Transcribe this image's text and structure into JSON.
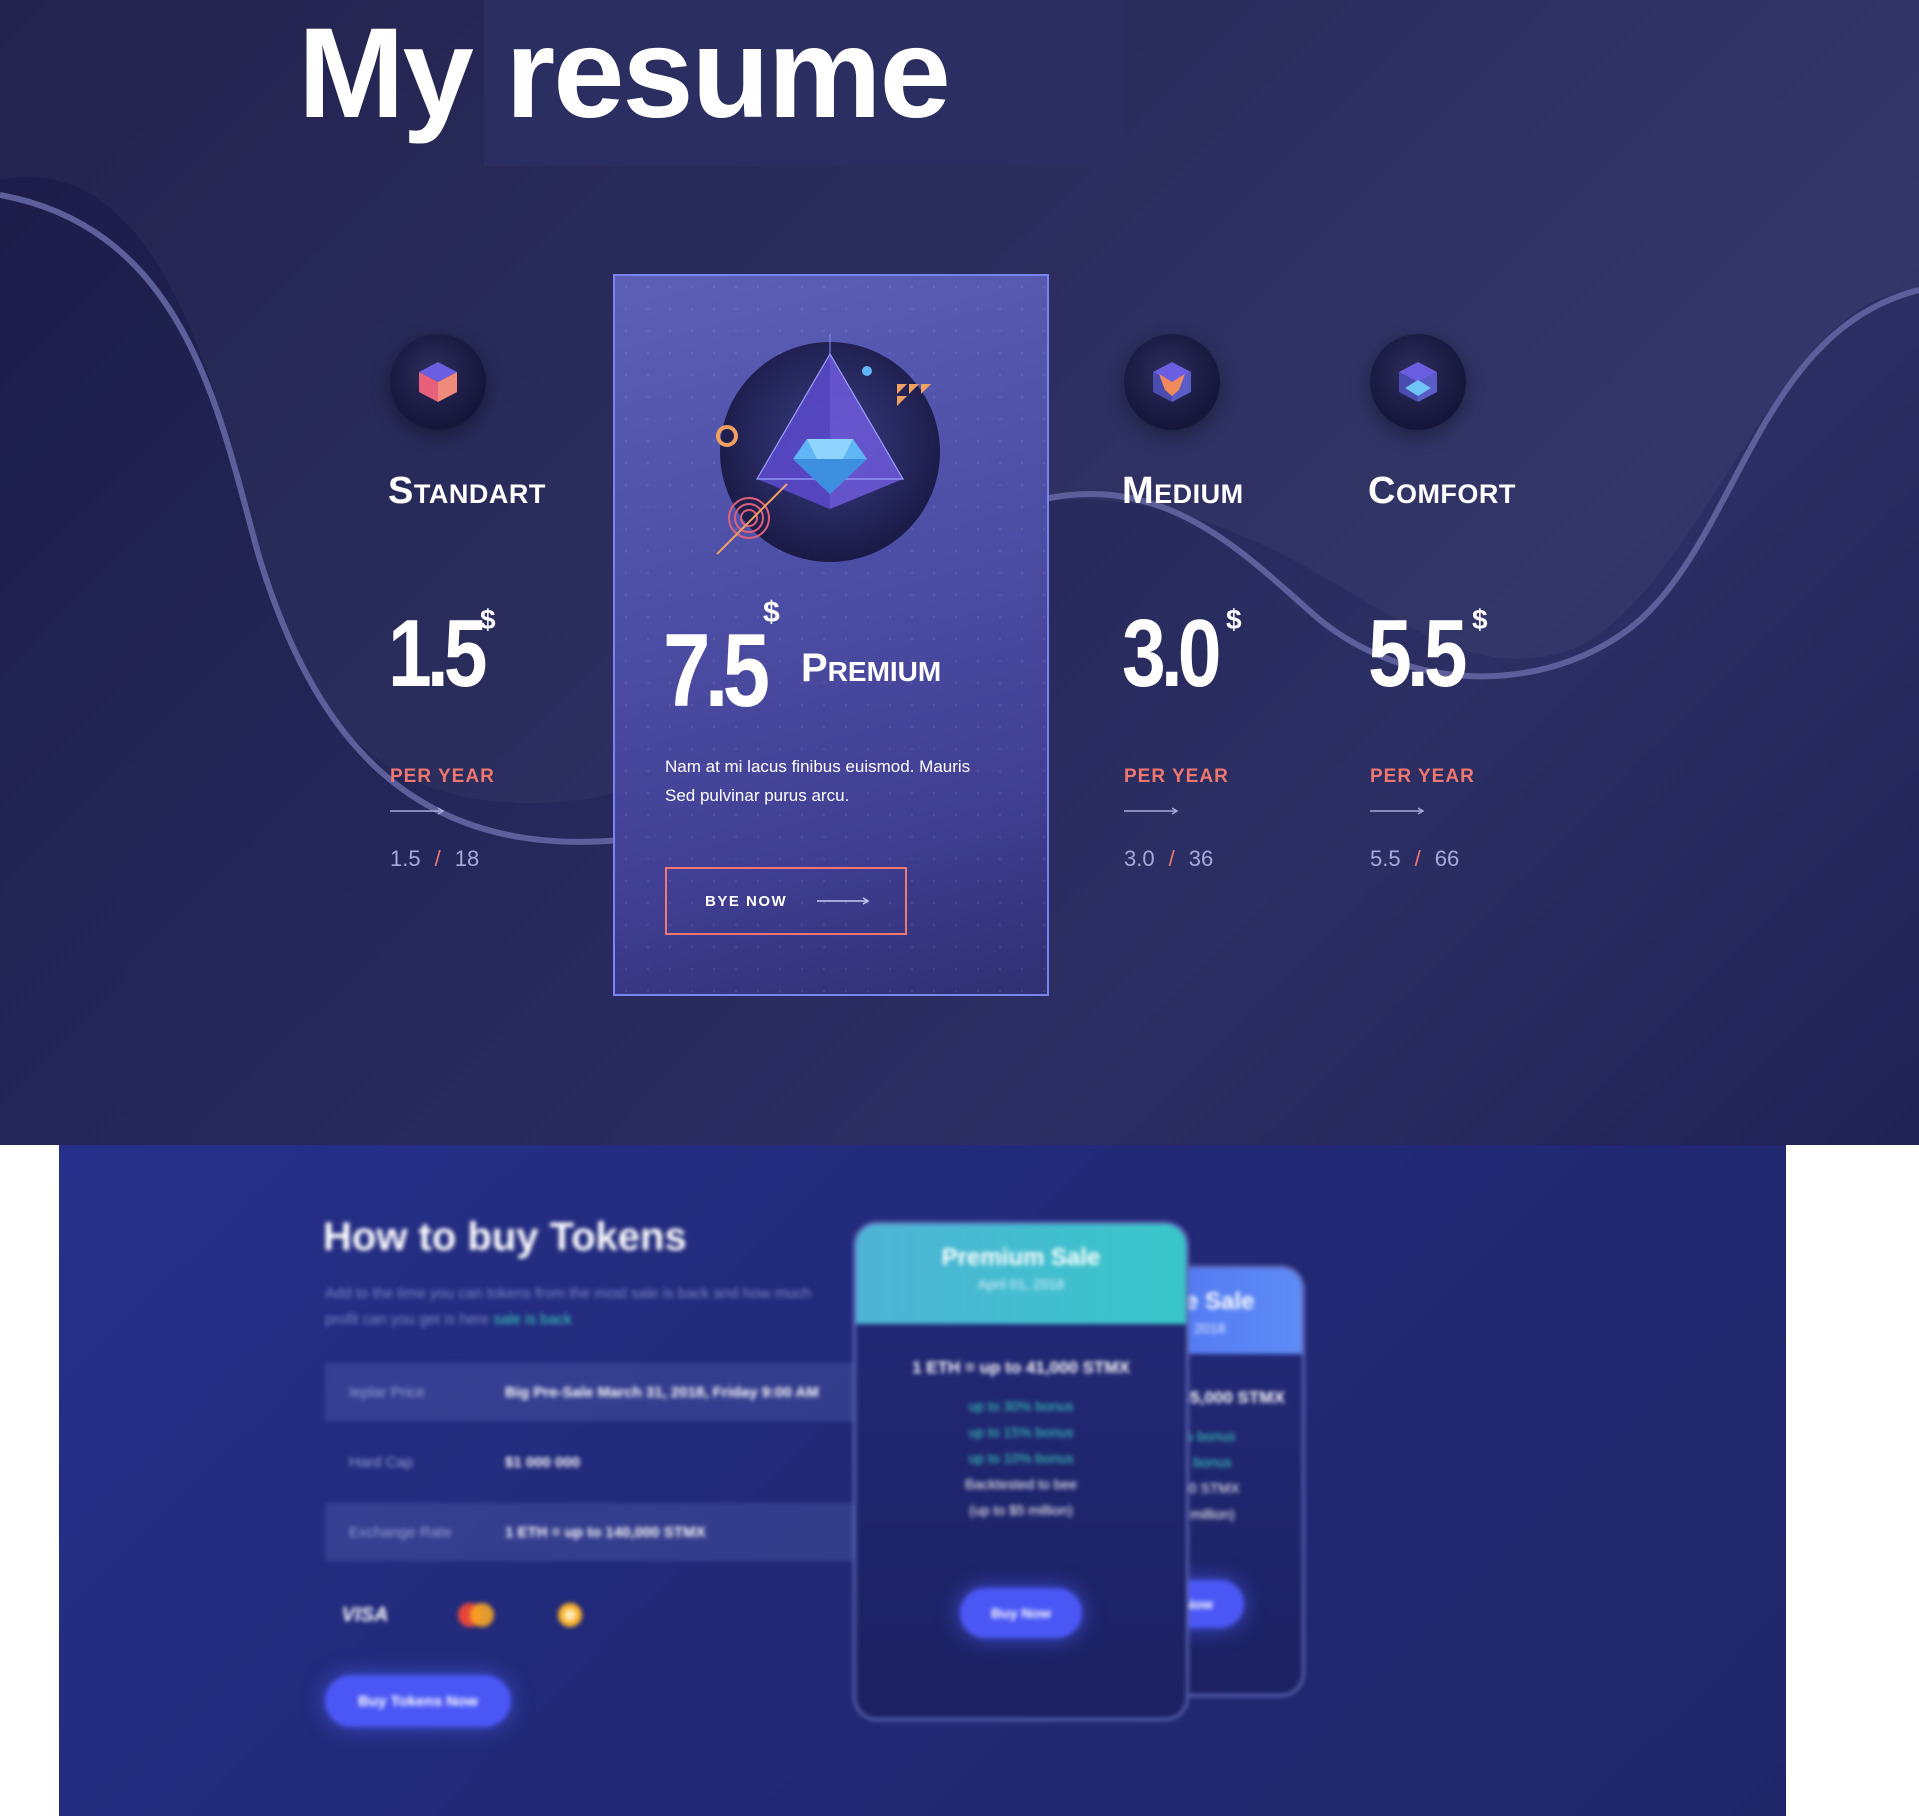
{
  "page": {
    "title": "My resume"
  },
  "pricing": {
    "plans": [
      {
        "name": "Standart",
        "price": "1.5",
        "currency": "$",
        "period": "PER YEAR",
        "ratio_a": "1.5",
        "ratio_sep": "/",
        "ratio_b": "18",
        "icon": "cube-icon"
      },
      {
        "name": "Medium",
        "price": "3.0",
        "currency": "$",
        "period": "PER YEAR",
        "ratio_a": "3.0",
        "ratio_sep": "/",
        "ratio_b": "36",
        "icon": "fox-cube-icon"
      },
      {
        "name": "Comfort",
        "price": "5.5",
        "currency": "$",
        "period": "PER YEAR",
        "ratio_a": "5.5",
        "ratio_sep": "/",
        "ratio_b": "66",
        "icon": "blue-cube-icon"
      }
    ],
    "premium": {
      "name": "Premium",
      "price": "7.5",
      "currency": "$",
      "description": "Nam at mi lacus finibus euismod. Mauris Sed pulvinar purus arcu.",
      "button_label": "BYE NOW",
      "icon": "diamond-pyramid-icon"
    },
    "colors": {
      "accent": "#f0776f",
      "background": "#25285a",
      "card": "#4d4fa6",
      "card_border": "#7b83ee"
    }
  },
  "tokens": {
    "title": "How to buy Tokens",
    "subtitle": "Add to the time you can tokens from the most sale is back and how much profit can you get is here",
    "subtitle_highlight": "sale is back",
    "info_rows": [
      {
        "label": "Ieplar Price",
        "value": "Big Pre-Sale March 31, 2018, Friday 9:00 AM"
      },
      {
        "label": "Hard Cap",
        "value": "$1 000 000"
      },
      {
        "label": "Exchange Rate",
        "value": "1 ETH = up to 140,000 STMX"
      }
    ],
    "payment_methods": [
      "VISA",
      "mastercard-icon",
      "bitcoin-icon"
    ],
    "buy_button": "Buy Tokens Now",
    "sale_cards": [
      {
        "title": "Premium Sale",
        "date": "April 01, 2018",
        "rate": "1 ETH = up to 41,000 STMX",
        "bonuses": [
          "up to 30% bonus",
          "up to 15% bonus",
          "up to 10% bonus"
        ],
        "extra": [
          "Backtested to bee",
          "(up to $5 million)"
        ],
        "button": "Buy Now",
        "header_color": "#4fb3d6"
      },
      {
        "title": "Feature Sale",
        "date": "May 31, 2018",
        "rate": "ETH = up to 35,000 STMX",
        "bonuses": [
          "up to 10% bonus",
          "up to 5% bonus"
        ],
        "extra": [
          "10,000,000 STMX",
          "(up to $6 million)"
        ],
        "button": "Buy Now",
        "header_color": "#4a6cf0"
      }
    ]
  }
}
